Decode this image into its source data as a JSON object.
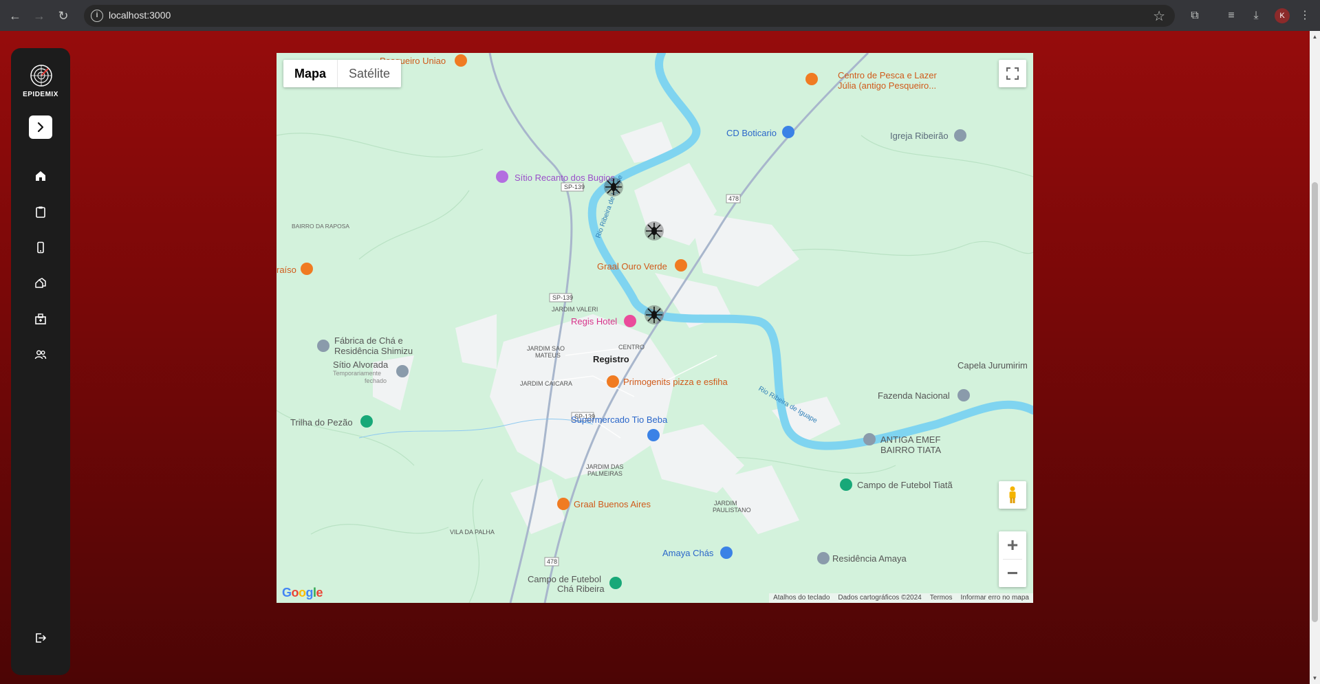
{
  "browser": {
    "url": "localhost:3000",
    "profile_initial": "K"
  },
  "app": {
    "name": "EPIDEMIX",
    "nav_items": [
      "home-icon",
      "clipboard-icon",
      "mobile-icon",
      "house-icon",
      "hospital-icon",
      "users-icon"
    ],
    "logout": "logout-icon"
  },
  "map": {
    "type_control": {
      "map": "Mapa",
      "satellite": "Satélite"
    },
    "labels": {
      "pesqueiro_uniao": "Pesqueiro Uniao",
      "centro_pesca": "Centro de Pesca e Lazer",
      "centro_pesca_2": "Júlia (antigo Pesqueiro...",
      "cd_boticario": "CD Boticario",
      "igreja": "Igreja Ribeirão",
      "sitio_recanto": "Sítio Recanto dos Bugios",
      "bairro_raposa": "BAIRRO DA RAPOSA",
      "paraiso": "raíso",
      "graal_ouro": "Graal Ouro Verde",
      "jardim_valeri": "JARDIM VALERI",
      "regis": "Regis Hotel",
      "fabrica": "Fábrica de Chá e",
      "fabrica_2": "Residência Shimizu",
      "sitio_alvorada": "Sítio Alvorada",
      "temp_fechado": "Temporariamente",
      "temp_fechado_2": "fechado",
      "jardim_sao_mateus": "JARDIM SAO",
      "jardim_sao_mateus_2": "MATEUS",
      "centro": "CENTRO",
      "registro": "Registro",
      "capela": "Capela Jurumirim",
      "jardim_caicara": "JARDIM CAICARA",
      "primogenits": "Primogenits pizza e esfiha",
      "fazenda": "Fazenda Nacional",
      "trilha": "Trilha do Pezão",
      "supermercado": "Supermercado Tio Beba",
      "rio": "Rio Ribeira de Iguape",
      "rio_2": "Rio Ribeira de Iguape",
      "antiga_emef": "ANTIGA EMEF",
      "antiga_emef_2": "BAIRRO TIATA",
      "jardim_palmeiras": "JARDIM DAS",
      "jardim_palmeiras_2": "PALMEIRAS",
      "campo_tiata": "Campo de Futebol Tiatã",
      "graal_buenos": "Graal Buenos Aires",
      "jardim_paulistano": "JARDIM",
      "jardim_paulistano_2": "PAULISTANO",
      "vila_palha": "VILA DA PALHA",
      "amaya_chas": "Amaya Chás",
      "residencia_amaya": "Residência Amaya",
      "campo_cha": "Campo de Futebol",
      "campo_cha_2": "Chá Ribeira",
      "sp139": "SP-139",
      "r478": "478"
    },
    "attribution": [
      "Atalhos do teclado",
      "Dados cartográficos ©2024",
      "Termos",
      "Informar erro no mapa"
    ],
    "brand": "Google"
  }
}
